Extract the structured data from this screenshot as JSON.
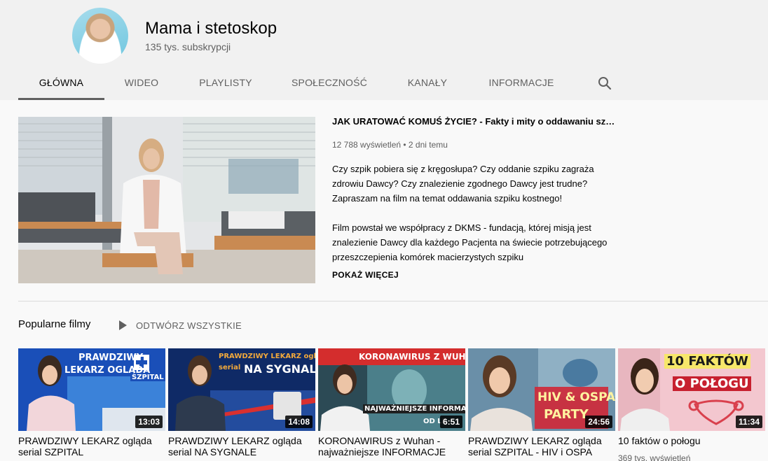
{
  "channel": {
    "name": "Mama i stetoskop",
    "subscribers": "135 tys. subskrypcji"
  },
  "tabs": [
    {
      "label": "GŁÓWNA",
      "active": true
    },
    {
      "label": "WIDEO"
    },
    {
      "label": "PLAYLISTY"
    },
    {
      "label": "SPOŁECZNOŚĆ"
    },
    {
      "label": "KANAŁY"
    },
    {
      "label": "INFORMACJE"
    }
  ],
  "search_icon": "search-icon",
  "featured": {
    "title": "JAK URATOWAĆ KOMUŚ ŻYCIE? - Fakty i mity o oddawaniu szpiku kostnego",
    "meta": "12 788 wyświetleń • 2 dni temu",
    "desc1": "Czy szpik pobiera się z kręgosłupa? Czy oddanie szpiku zagraża zdrowiu Dawcy? Czy znalezienie zgodnego Dawcy jest trudne? Zapraszam na film na temat oddawania szpiku kostnego!",
    "desc2": "Film powstał we współpracy z DKMS - fundacją, której misją jest znalezienie Dawcy dla każdego Pacjenta na świecie potrzebującego przeszczepienia komórek macierzystych szpiku",
    "show_more": "POKAŻ WIĘCEJ"
  },
  "popular": {
    "title": "Popularne filmy",
    "play_all": "ODTWÓRZ WSZYSTKIE",
    "videos": [
      {
        "title": "PRAWDZIWY LEKARZ ogląda serial SZPITAL",
        "duration": "13:03",
        "thumb_lines": [
          "PRAWDZIWY",
          "LEKARZ OGLĄDA",
          "SZPITAL"
        ]
      },
      {
        "title": "PRAWDZIWY LEKARZ ogląda serial NA SYGNALE",
        "duration": "14:08",
        "thumb_lines": [
          "PRAWDZIWY LEKARZ ogląda",
          "serial",
          "NA SYGNALE"
        ]
      },
      {
        "title": "KORONAWIRUS z Wuhan - najważniejsze INFORMACJE",
        "duration": "6:51",
        "thumb_lines": [
          "KORONAWIRUS Z WUHAN",
          "NAJWAŻNIEJSZE INFORMACJE",
          "OD LE"
        ]
      },
      {
        "title": "PRAWDZIWY LEKARZ ogląda serial SZPITAL - HIV i OSPA",
        "duration": "24:56",
        "thumb_lines": [
          "HIV & OSPA",
          "PARTY"
        ]
      },
      {
        "title": "10 faktów o połogu",
        "duration": "11:34",
        "views": "369 tys. wyświetleń",
        "thumb_lines": [
          "10 FAKTÓW",
          "O POŁOGU"
        ]
      }
    ]
  }
}
